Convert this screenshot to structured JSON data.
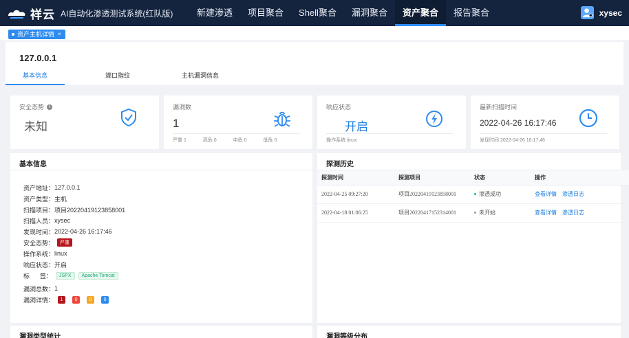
{
  "app": {
    "brand": "祥云",
    "subtitle": "AI自动化渗透测试系统(红队版)",
    "user": "xysec"
  },
  "nav": {
    "items": [
      {
        "label": "新建渗透",
        "active": false
      },
      {
        "label": "项目聚合",
        "active": false
      },
      {
        "label": "Shell聚合",
        "active": false
      },
      {
        "label": "漏洞聚合",
        "active": false
      },
      {
        "label": "资产聚合",
        "active": true
      },
      {
        "label": "报告聚合",
        "active": false
      }
    ]
  },
  "page_tab": {
    "label": "资产主机详情",
    "close": "×"
  },
  "header": {
    "ip": "127.0.0.1",
    "tabs": [
      "基本信息",
      "端口指纹",
      "主机漏洞信息"
    ],
    "active_tab": 0
  },
  "cards": {
    "security": {
      "label": "安全态势",
      "value": "未知",
      "icon": "shield-check-icon"
    },
    "vulns": {
      "label": "漏洞数",
      "value": "1",
      "icon": "bug-icon",
      "footer": [
        "严重 1",
        "高危 0",
        "中危 0",
        "低危 0"
      ]
    },
    "response": {
      "label": "响应状态",
      "value": "开启",
      "icon": "lightning-icon",
      "footer": "操作系统 linux"
    },
    "last_scan": {
      "label": "最新扫描时间",
      "value": "2022-04-26 16:17:46",
      "icon": "clock-icon",
      "footer": "发现时间 2022-04-26 16:17:46"
    }
  },
  "basic_info": {
    "title": "基本信息",
    "rows": [
      {
        "key": "资产地址：",
        "value": "127.0.0.1"
      },
      {
        "key": "资产类型：",
        "value": "主机"
      },
      {
        "key": "扫描项目：",
        "value": "项目20220419123858001"
      },
      {
        "key": "扫描人员：",
        "value": "xysec"
      },
      {
        "key": "发现时间：",
        "value": "2022-04-26 16:17:46"
      }
    ],
    "security_key": "安全态势：",
    "security_badge": "严重",
    "os_key": "操作系统：",
    "os_value": "linux",
    "resp_key": "响应状态：",
    "resp_value": "开启",
    "tags_key": "标      签：",
    "tags": [
      "JSPX",
      "Apache Tomcat"
    ],
    "total_key": "漏洞总数：",
    "total_value": "1",
    "detail_key": "漏洞详情：",
    "detail_counts": [
      {
        "value": "1",
        "color": "#b4151b"
      },
      {
        "value": "0",
        "color": "#f0483e"
      },
      {
        "value": "0",
        "color": "#f5a623"
      },
      {
        "value": "0",
        "color": "#2e8cf0"
      }
    ]
  },
  "history": {
    "title": "探测历史",
    "columns": [
      "探测时间",
      "探测项目",
      "状态",
      "操作"
    ],
    "rows": [
      {
        "time": "2022-04-25 09:27:20",
        "project": "项目20220419123858001",
        "status": "渗透成功",
        "status_color": "#19be6b",
        "actions": [
          "查看详情",
          "渗透日志"
        ]
      },
      {
        "time": "2022-04-18 01:06:25",
        "project": "项目20220417152314001",
        "status": "未开始",
        "status_color": "#999999",
        "actions": [
          "查看详情",
          "渗透日志"
        ]
      }
    ]
  },
  "bottom": {
    "vuln_type_title": "漏洞类型统计",
    "vuln_level_title": "漏洞等级分布"
  },
  "colors": {
    "nav_bg": "#14233e",
    "accent": "#2e8cf0",
    "icon_blue": "#2e8cf0"
  }
}
